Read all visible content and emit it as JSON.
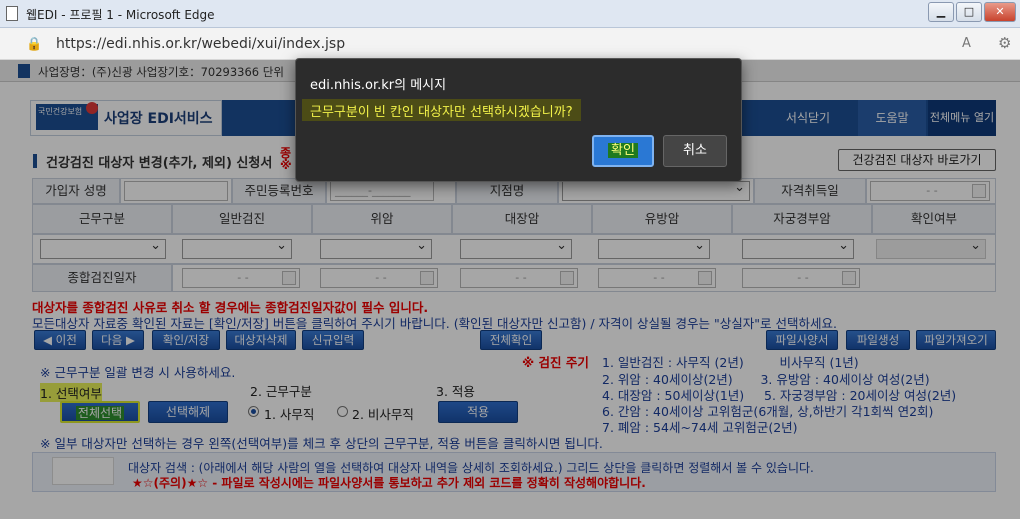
{
  "window": {
    "title": "웹EDI - 프로필 1 - Microsoft Edge"
  },
  "browser": {
    "url": "https://edi.nhis.or.kr/webedi/xui/index.jsp"
  },
  "infostrip": {
    "text": "사업장명：(주)신광 사업장기호：70293366 단위"
  },
  "header": {
    "logo": "국민건강보험",
    "title": "사업장 EDI서비스",
    "buttons": [
      "서식닫기",
      "도움말",
      "전체메뉴 열기"
    ]
  },
  "section": {
    "title": "건강검진 대상자 변경(추가, 제외) 신청서",
    "red_mark_1": "종",
    "red_mark_2": "※",
    "shortcut_button": "건강검진 대상자 바로가기"
  },
  "form": {
    "row1": {
      "name_label": "가입자 성명",
      "rrn_label": "주민등록번호",
      "rrn_placeholder": "______-_______",
      "branch_label": "지점명",
      "acquire_label": "자격취득일",
      "acquire_value": "-   -"
    },
    "columns": [
      "근무구분",
      "일반검진",
      "위암",
      "대장암",
      "유방암",
      "자궁경부암",
      "확인여부"
    ],
    "date_label": "종합검진일자",
    "date_value": "-   -"
  },
  "notices": {
    "line1": "대상자를 종합검진 사유로 취소 할 경우에는 종합검진일자값이 필수 입니다.",
    "line2": "모든대상자 자료중 확인된 자료는 [확인/저장] 버튼을 클릭하여 주시기 바랍니다. (확인된 대상자만 신고함) / 자격이 상실될 경우는 \"상실자\"로 선택하세요."
  },
  "toolbar": {
    "prev": "◀ 이전",
    "next": "다음 ▶",
    "confirm_save": "확인/저장",
    "delete_target": "대상자삭제",
    "new_input": "신규입력",
    "confirm_all": "전체확인",
    "file_spec": "파일사양서",
    "file_create": "파일생성",
    "file_import": "파일가져오기"
  },
  "bulk": {
    "heading": "※ 근무구분 일괄 변경 시 사용하세요.",
    "step1": "1. 선택여부",
    "step2": "2. 근무구분",
    "step3": "3. 적용",
    "select_all": "전체선택",
    "deselect_all": "선택해제",
    "radio1": "1. 사무직",
    "radio2": "2. 비사무직",
    "apply": "적용",
    "footnote": "※ 일부 대상자만 선택하는 경우 왼쪽(선택여부)를 체크 후 상단의 근무구분, 적용 버튼을 클릭하시면 됩니다."
  },
  "cycle": {
    "title": "※ 검진 주기",
    "lines": [
      "1. 일반검진 : 사무직 (2년)         비사무직 (1년)",
      "2. 위암 : 40세이상(2년)       3. 유방암 : 40세이상 여성(2년)",
      "4. 대장암 : 50세이상(1년)     5. 자궁경부암 : 20세이상 여성(2년)",
      "6. 간암 : 40세이상 고위험군(6개월, 상,하반기 각1회씩 연2회)",
      "7. 폐암 : 54세~74세 고위험군(2년)"
    ]
  },
  "infobox": {
    "search_line": "대상자 검색 : (아래에서 해당 사람의 열을 선택하여 대상자 내역을 상세히 조회하세요.) 그리드 상단을 클릭하면 정렬해서 볼 수 있습니다.",
    "warning_line": "★☆(주의)★☆ - 파일로 작성시에는 파일사양서를 통보하고 추가 제외 코드를 정확히 작성해야합니다."
  },
  "dialog": {
    "title": "edi.nhis.or.kr의 메시지",
    "message": "근무구분이 빈 칸인 대상자만 선택하시겠습니까?",
    "ok": "확인",
    "cancel": "취소"
  }
}
